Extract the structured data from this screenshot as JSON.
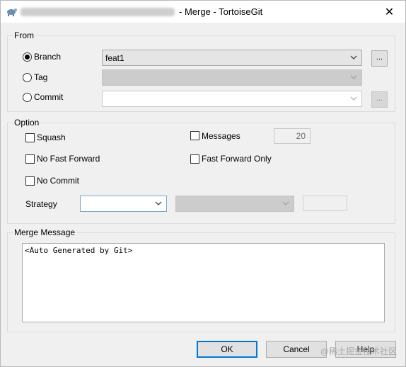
{
  "window": {
    "title": "- Merge - TortoiseGit",
    "close_glyph": "✕",
    "app_icon": "tortoisegit-icon"
  },
  "from": {
    "label": "From",
    "branch": {
      "label": "Branch",
      "selected": true,
      "value": "feat1",
      "browse": "..."
    },
    "tag": {
      "label": "Tag",
      "selected": false,
      "value": ""
    },
    "commit": {
      "label": "Commit",
      "selected": false,
      "value": "",
      "browse": "..."
    }
  },
  "option": {
    "label": "Option",
    "squash": {
      "label": "Squash",
      "checked": false
    },
    "no_fast_forward": {
      "label": "No Fast Forward",
      "checked": false
    },
    "no_commit": {
      "label": "No Commit",
      "checked": false
    },
    "messages": {
      "label": "Messages",
      "checked": false,
      "count": "20"
    },
    "fast_forward_only": {
      "label": "Fast Forward Only",
      "checked": false
    },
    "strategy": {
      "label": "Strategy",
      "value": "",
      "option_value": "",
      "param": ""
    }
  },
  "merge_message": {
    "label": "Merge Message",
    "text": "<Auto Generated by Git>"
  },
  "buttons": {
    "ok": "OK",
    "cancel": "Cancel",
    "help": "Help"
  },
  "watermark": "@稀土掘金技术社区",
  "colors": {
    "accent": "#0078d7",
    "dialog_bg": "#f0f0f0"
  }
}
